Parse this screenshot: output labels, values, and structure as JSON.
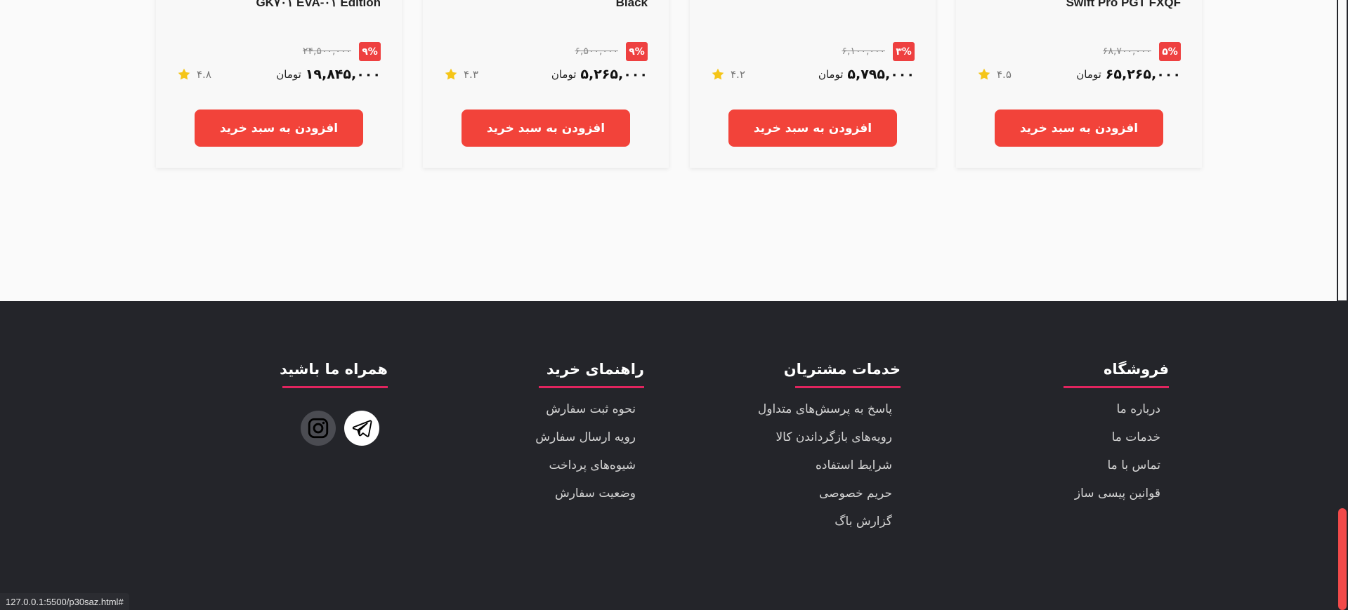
{
  "products": [
    {
      "name": "Swift Pro PGT FXQF",
      "discount": "۵%",
      "old_price": "۶۸,۷۰۰,۰۰۰",
      "price": "۶۵,۲۶۵,۰۰۰",
      "currency": "تومان",
      "rating": "۴.۵",
      "button": "افزودن به سبد خرید"
    },
    {
      "name": "",
      "discount": "۳%",
      "old_price": "۶,۱۰۰,۰۰۰",
      "price": "۵,۷۹۵,۰۰۰",
      "currency": "تومان",
      "rating": "۴.۲",
      "button": "افزودن به سبد خرید"
    },
    {
      "name": "Black",
      "discount": "۹%",
      "old_price": "۶,۵۰۰,۰۰۰",
      "price": "۵,۲۶۵,۰۰۰",
      "currency": "تومان",
      "rating": "۴.۳",
      "button": "افزودن به سبد خرید"
    },
    {
      "name": "GK۷۰۱ EVA-۰۱ Edition",
      "discount": "۹%",
      "old_price": "۲۴,۵۰۰,۰۰۰",
      "price": "۱۹,۸۴۵,۰۰۰",
      "currency": "تومان",
      "rating": "۴.۸",
      "button": "افزودن به سبد خرید"
    }
  ],
  "footer": {
    "store": {
      "title": "فروشگاه",
      "links": [
        "درباره ما",
        "خدمات ما",
        "تماس با ما",
        "قوانین پیسی ساز"
      ]
    },
    "services": {
      "title": "خدمات مشتریان",
      "links": [
        "پاسخ به پرسش‌های متداول",
        "رویه‌های بازگرداندن کالا",
        "شرایط استفاده",
        "حریم خصوصی",
        "گزارش باگ"
      ]
    },
    "guide": {
      "title": "راهنمای خرید",
      "links": [
        "نحوه ثبت سفارش",
        "رویه ارسال سفارش",
        "شیوه‌های پرداخت",
        "وضعیت سفارش"
      ]
    },
    "follow": {
      "title": "همراه ما باشید",
      "icons": [
        "telegram-icon",
        "instagram-icon"
      ]
    }
  },
  "colors": {
    "accent": "#f2433a",
    "footer_bg": "#24252a",
    "underline": "#e0245e",
    "star": "#f5c518"
  },
  "status_url": "127.0.0.1:5500/p30saz.html#"
}
